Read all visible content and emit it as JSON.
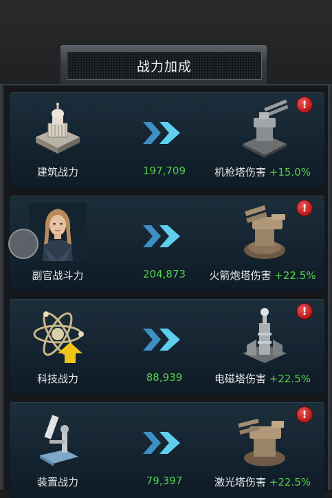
{
  "title": "战力加成",
  "rows": [
    {
      "left_label": "建筑战力",
      "value": "197,709",
      "right_name": "机枪塔伤害",
      "right_bonus": "+15.0%",
      "left_icon": "building-icon",
      "right_icon": "machine-gun-tower-icon"
    },
    {
      "left_label": "副官战斗力",
      "value": "204,873",
      "right_name": "火箭炮塔伤害",
      "right_bonus": "+22.5%",
      "left_icon": "officer-portrait-icon",
      "right_icon": "rocket-tower-icon"
    },
    {
      "left_label": "科技战力",
      "value": "88,939",
      "right_name": "电磁塔伤害",
      "right_bonus": "+22.5%",
      "left_icon": "atom-tech-icon",
      "right_icon": "tesla-tower-icon"
    },
    {
      "left_label": "装置战力",
      "value": "79,397",
      "right_name": "激光塔伤害",
      "right_bonus": "+22.5%",
      "left_icon": "microscope-icon",
      "right_icon": "laser-tower-icon"
    }
  ],
  "alert_symbol": "!",
  "colors": {
    "accent_green": "#54d24a",
    "alert_red": "#d42424",
    "arrow_cyan": "#4fc3e8"
  }
}
